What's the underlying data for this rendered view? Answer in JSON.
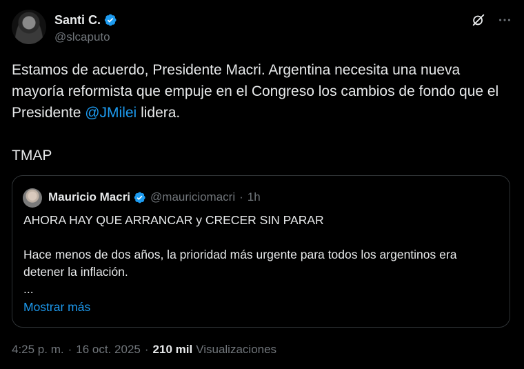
{
  "author": {
    "name": "Santi C.",
    "handle": "@slcaputo"
  },
  "tweet": {
    "text_before_mention": "Estamos de acuerdo, Presidente Macri. Argentina necesita una nueva mayoría reformista que empuje en el Congreso los cambios de fondo que el Presidente ",
    "mention": "@JMilei",
    "text_after_mention": " lidera.",
    "signoff": "TMAP"
  },
  "quote": {
    "name": "Mauricio Macri",
    "handle": "@mauriciomacri",
    "separator": "·",
    "time": "1h",
    "text": "AHORA HAY QUE ARRANCAR y CRECER SIN PARAR\n\nHace menos de dos años, la prioridad más urgente para todos los argentinos era detener la inflación.\n...",
    "show_more": "Mostrar más"
  },
  "meta": {
    "time": "4:25 p. m.",
    "date": "16 oct. 2025",
    "separator": "·",
    "views_count": "210 mil",
    "views_label": "Visualizaciones"
  },
  "colors": {
    "background": "#000000",
    "text": "#e7e9ea",
    "muted": "#71767b",
    "accent": "#1d9bf0",
    "border": "#2f3336"
  },
  "icons": {
    "verified": "verified-badge-icon",
    "grok": "grok-icon",
    "more": "more-dots-icon"
  }
}
